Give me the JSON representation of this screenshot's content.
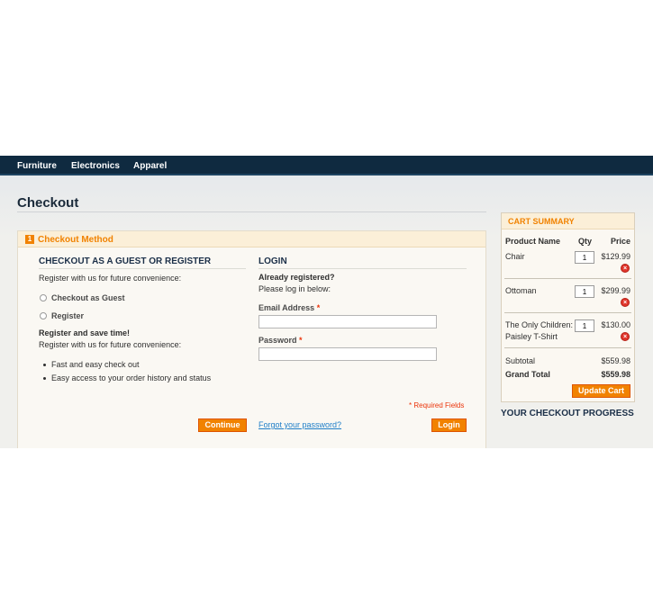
{
  "nav": {
    "items": [
      "Furniture",
      "Electronics",
      "Apparel"
    ]
  },
  "page": {
    "title": "Checkout"
  },
  "step": {
    "number": "1",
    "title": "Checkout Method"
  },
  "guest": {
    "heading": "CHECKOUT AS A GUEST OR REGISTER",
    "intro": "Register with us for future convenience:",
    "options": [
      "Checkout as Guest",
      "Register"
    ],
    "save_heading": "Register and save time!",
    "save_text": "Register with us for future convenience:",
    "benefits": [
      "Fast and easy check out",
      "Easy access to your order history and status"
    ],
    "continue_label": "Continue"
  },
  "login": {
    "heading": "LOGIN",
    "already": "Already registered?",
    "please": "Please log in below:",
    "email_label": "Email Address",
    "password_label": "Password",
    "required_mark": "*",
    "email_value": "",
    "password_value": "",
    "required_note": "* Required Fields",
    "forgot_label": "Forgot your password?",
    "login_label": "Login"
  },
  "cart": {
    "title": "CART SUMMARY",
    "columns": [
      "Product Name",
      "Qty",
      "Price"
    ],
    "items": [
      {
        "name": "Chair",
        "qty": "1",
        "price": "$129.99"
      },
      {
        "name": "Ottoman",
        "qty": "1",
        "price": "$299.99"
      },
      {
        "name": "The Only Children: Paisley T-Shirt",
        "qty": "1",
        "price": "$130.00"
      }
    ],
    "subtotal_label": "Subtotal",
    "subtotal_value": "$559.98",
    "grand_total_label": "Grand Total",
    "grand_total_value": "$559.98",
    "update_label": "Update Cart"
  },
  "progress": {
    "title": "YOUR CHECKOUT PROGRESS"
  },
  "colors": {
    "nav_bg": "#0f2a40",
    "accent": "#f18200",
    "link": "#1e7ec8",
    "required": "#eb340a"
  }
}
